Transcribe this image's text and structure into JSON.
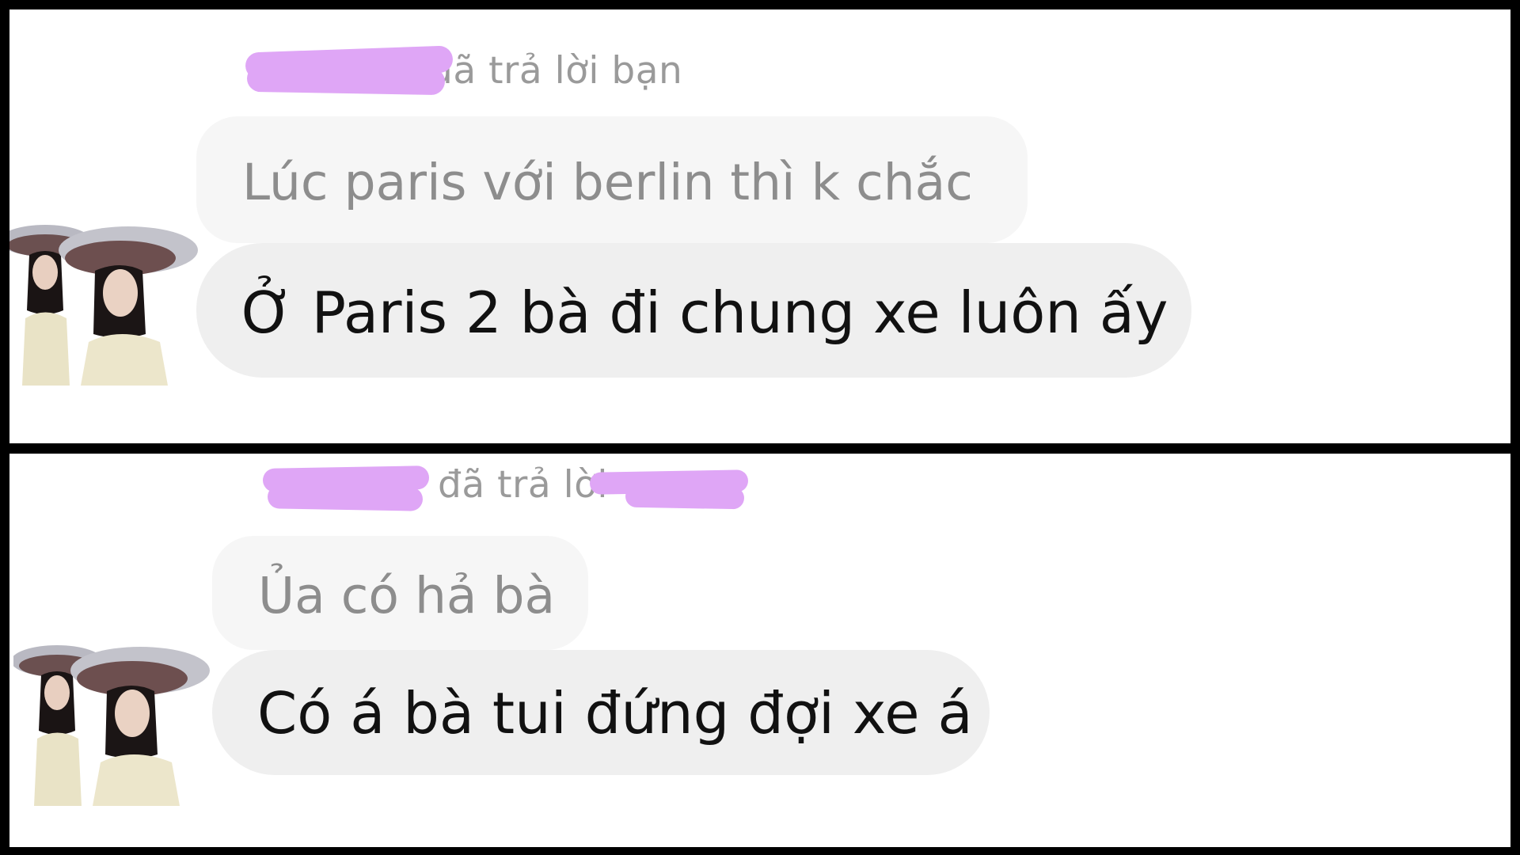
{
  "conversation": {
    "panel1": {
      "reply_header": "đã trả lời bạn",
      "quoted_message": "Lúc paris với berlin thì k chắc",
      "message": "Ở Paris 2 bà đi chung xe luôn ấy",
      "avatar": "sender-avatar"
    },
    "panel2": {
      "reply_header": "đã trả lời",
      "quoted_message": "Ủa có hả bà",
      "message": "Có á bà tui đứng đợi xe á",
      "avatar": "sender-avatar"
    }
  },
  "colors": {
    "redaction": "#dfa6f6",
    "quoted_bubble": "#f6f6f6",
    "message_bubble": "#efefef",
    "header_text": "#9a9a9a",
    "border": "#000000"
  }
}
